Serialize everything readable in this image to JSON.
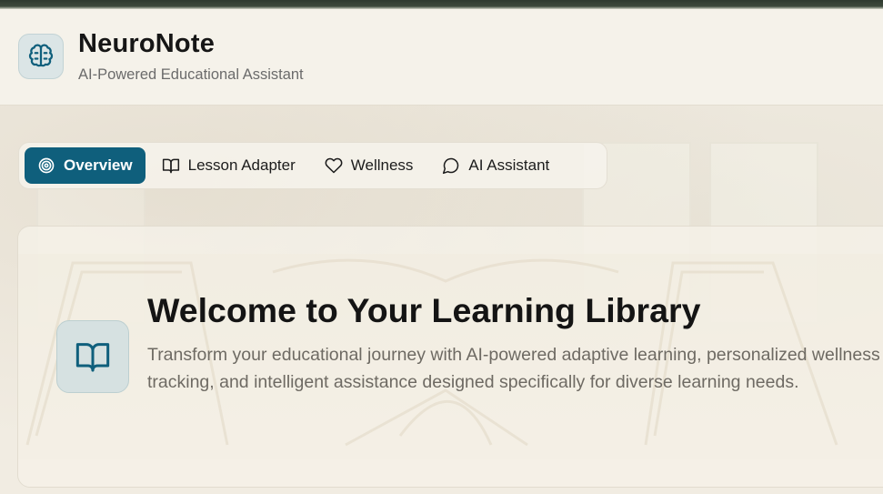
{
  "app": {
    "title": "NeuroNote",
    "subtitle": "AI-Powered Educational Assistant",
    "logo_icon": "brain-icon"
  },
  "tabs": [
    {
      "label": "Overview",
      "icon": "target-icon",
      "active": true
    },
    {
      "label": "Lesson Adapter",
      "icon": "book-open-icon",
      "active": false
    },
    {
      "label": "Wellness",
      "icon": "heart-icon",
      "active": false
    },
    {
      "label": "AI Assistant",
      "icon": "chat-bubble-icon",
      "active": false
    }
  ],
  "hero": {
    "icon": "book-open-icon",
    "title": "Welcome to Your Learning Library",
    "description": "Transform your educational journey with AI-powered adaptive learning, personalized wellness tracking, and intelligent assistance designed specifically for diverse learning needs."
  },
  "colors": {
    "accent": "#0f5f7c",
    "background": "#f3efe6",
    "text": "#161616",
    "muted": "#6b6b6b"
  }
}
